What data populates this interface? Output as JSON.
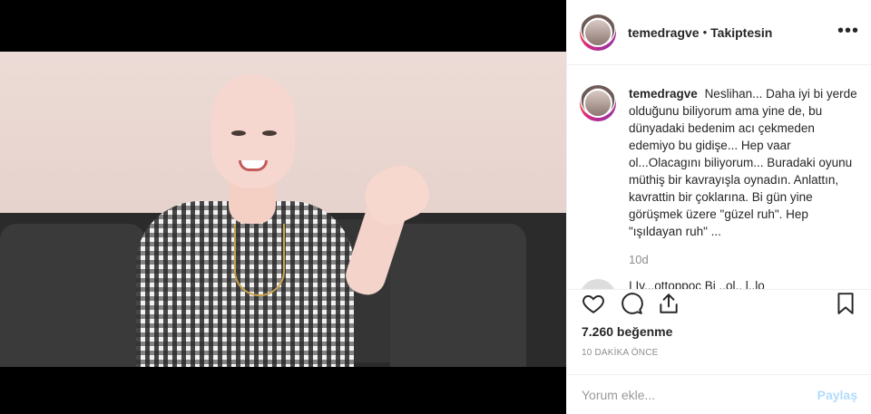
{
  "post": {
    "username": "temedragve",
    "separator": "•",
    "follow_status": "Takiptesin",
    "more_label": "•••"
  },
  "caption": {
    "username": "temedragve",
    "text": "Neslihan... Daha iyi bi yerde olduğunu biliyorum ama yine de, bu dünyadaki bedenim acı çekmeden edemiyo bu gidişe... Hep vaar ol...Olacagını biliyorum... Buradaki oyunu müthiş bir kavrayışla oynadın. Anlattın, kavrattin bir çoklarına. Bi gün yine görüşmek üzere \"güzel ruh\". Hep \"ışıldayan ruh\" ...",
    "age": "10d"
  },
  "next_comment": {
    "text": "I Iv...ottoppoc    Bi  ..ol..   l..lo"
  },
  "actions": {
    "like_icon": "heart-icon",
    "comment_icon": "speech-bubble-icon",
    "share_icon": "share-icon",
    "save_icon": "bookmark-icon"
  },
  "likes": "7.260 beğenme",
  "timestamp": "10 DAKİKA ÖNCE",
  "comment_box": {
    "placeholder": "Yorum ekle...",
    "post_label": "Paylaş"
  },
  "colors": {
    "text": "#262626",
    "muted": "#8e8e8e",
    "post_disabled": "#b3dbff",
    "border": "#efefef"
  }
}
